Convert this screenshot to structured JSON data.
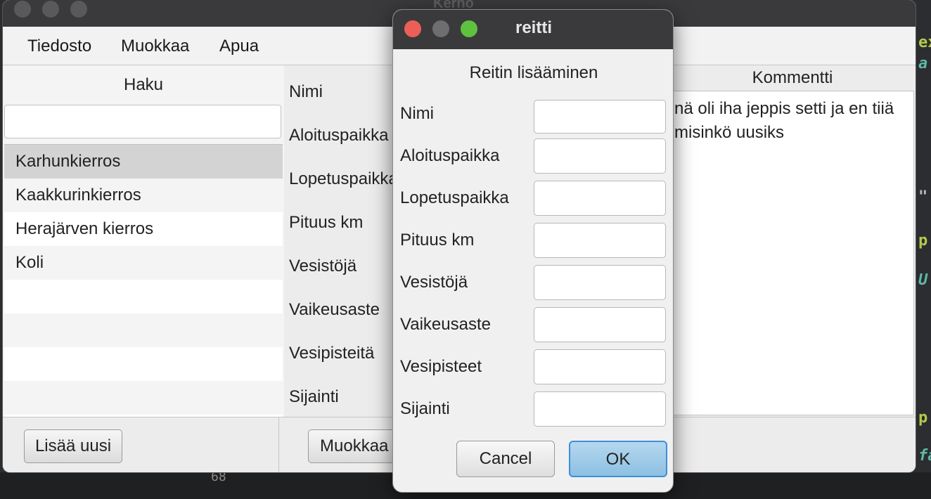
{
  "main_window": {
    "title": "Kerho",
    "menu": [
      "Tiedosto",
      "Muokkaa",
      "Apua"
    ],
    "search_label": "Haku",
    "search_value": "",
    "routes": [
      "Karhunkierros",
      "Kaakkurinkierros",
      "Herajärven kierros",
      "Koli"
    ],
    "field_labels": [
      "Nimi",
      "Aloituspaikka",
      "Lopetuspaikka",
      "Pituus km",
      "Vesistöjä",
      "Vaikeusaste",
      "Vesipisteitä",
      "Sijainti"
    ],
    "comment_header": "Kommentti",
    "comment_text": "nä oli iha jeppis setti ja en tiiä\nmisinkö uusiks",
    "add_button": "Lisää uusi",
    "edit_button": "Muokkaa"
  },
  "dialog": {
    "title": "reitti",
    "heading": "Reitin lisääminen",
    "fields": [
      {
        "label": "Nimi",
        "value": ""
      },
      {
        "label": "Aloituspaikka",
        "value": ""
      },
      {
        "label": "Lopetuspaikka",
        "value": ""
      },
      {
        "label": "Pituus km",
        "value": ""
      },
      {
        "label": "Vesistöjä",
        "value": ""
      },
      {
        "label": "Vaikeusaste",
        "value": ""
      },
      {
        "label": "Vesipisteet",
        "value": ""
      },
      {
        "label": "Sijainti",
        "value": ""
      }
    ],
    "cancel_label": "Cancel",
    "ok_label": "OK"
  },
  "background_editor": {
    "gutter_line": "68"
  },
  "colors": {
    "close": "#ec5f57",
    "minimize": "#6e6e70",
    "zoom": "#5fc23f",
    "ok_accent": "#3d8fd8"
  }
}
